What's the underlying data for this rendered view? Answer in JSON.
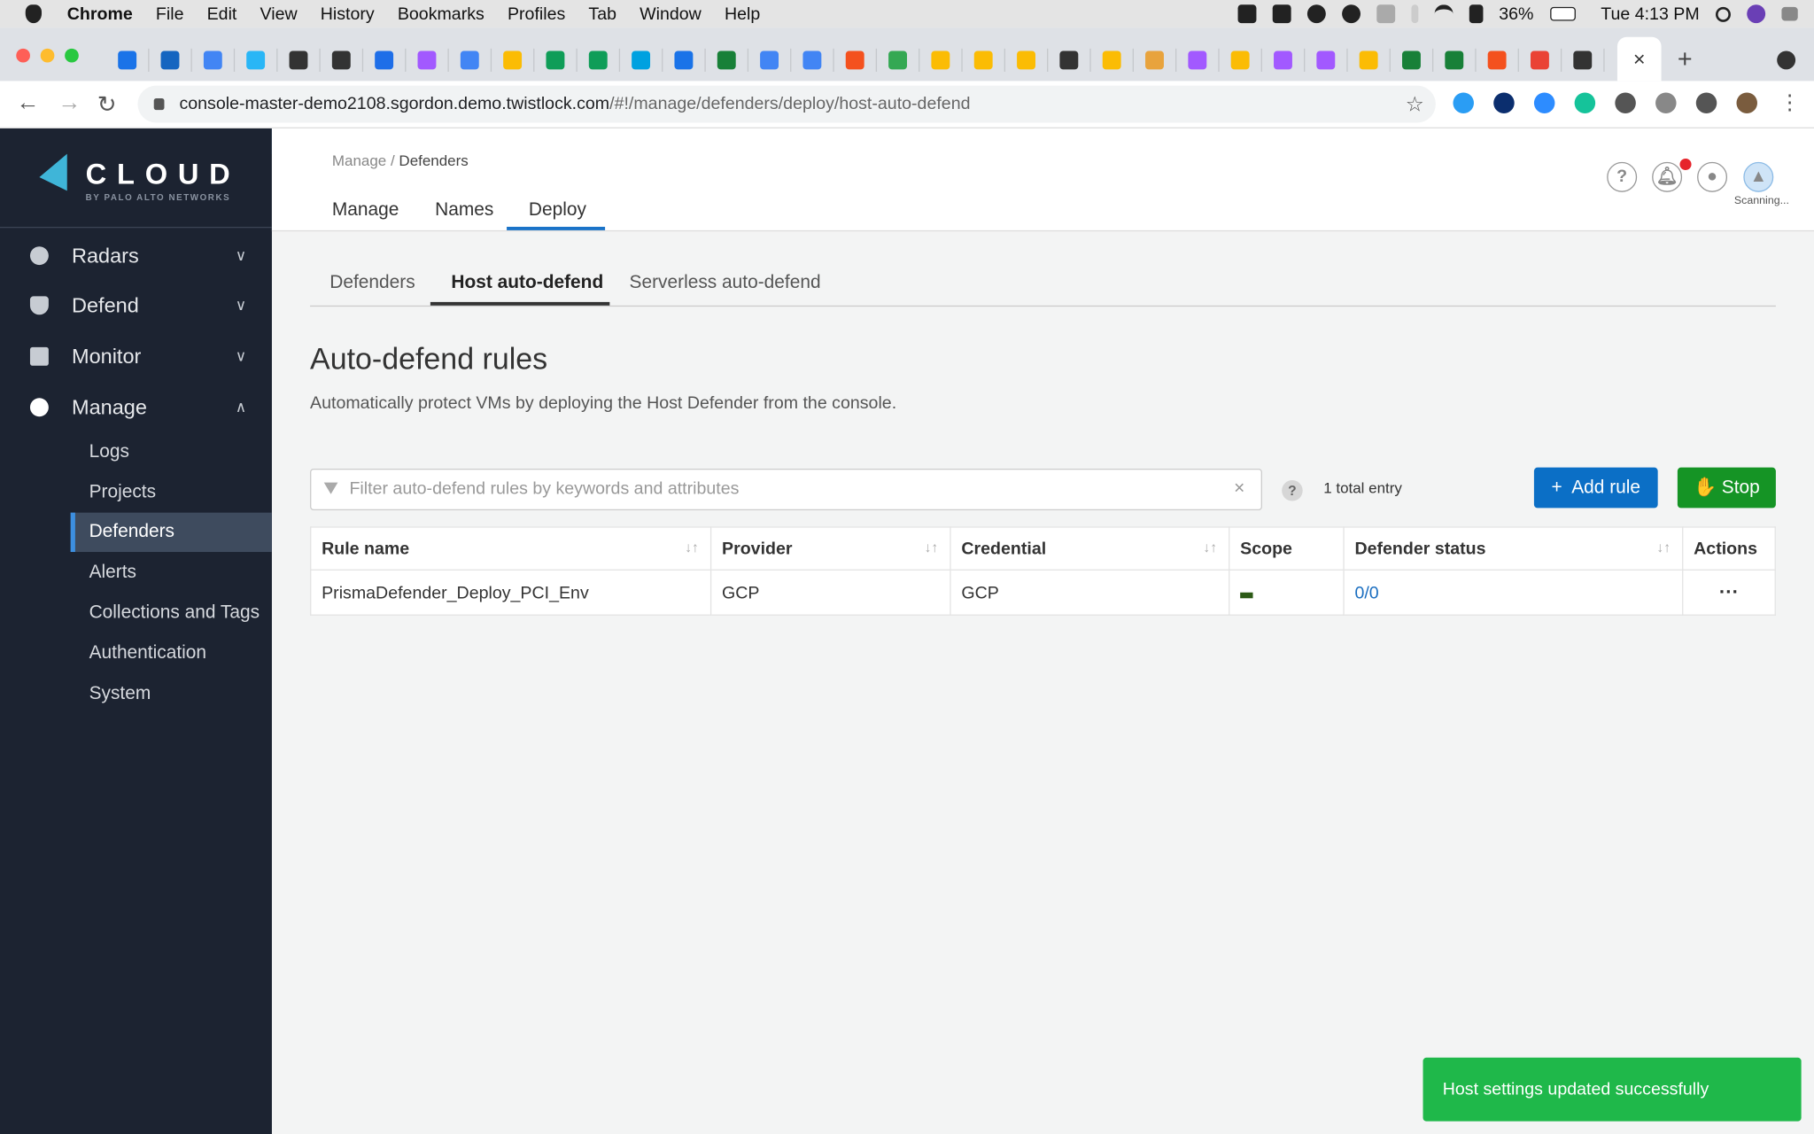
{
  "macos_menubar": {
    "app": "Chrome",
    "menus": [
      "File",
      "Edit",
      "View",
      "History",
      "Bookmarks",
      "Profiles",
      "Tab",
      "Window",
      "Help"
    ],
    "battery": "36%",
    "clock": "Tue 4:13 PM"
  },
  "browser": {
    "tab_icon_colors": [
      "#1a73e8",
      "#1565c0",
      "#4285f4",
      "#29b6f6",
      "#333333",
      "#333333",
      "#1e6ee8",
      "#a259ff",
      "#4285f4",
      "#fbbc04",
      "#0f9d58",
      "#0f9d58",
      "#00a1e0",
      "#1a73e8",
      "#188038",
      "#4285f4",
      "#4285f4",
      "#f4511e",
      "#34a853",
      "#fbbc04",
      "#fbbc04",
      "#fbbc04",
      "#333333",
      "#fbbc04",
      "#e8a33d",
      "#a259ff",
      "#fbbc04",
      "#a259ff",
      "#a259ff",
      "#fbbc04",
      "#188038",
      "#188038",
      "#f4511e",
      "#ea4335",
      "#333333"
    ],
    "active_tab_close": "×",
    "new_tab": "+",
    "url_host": "console-master-demo2108.sgordon.demo.twistlock.com",
    "url_path": "/#!/manage/defenders/deploy/host-auto-defend",
    "extension_colors": [
      "#2a9df4",
      "#0b2e6e",
      "#2d8cff",
      "#15c39a",
      "#555555",
      "#888888",
      "#555555",
      "#7a5c3e"
    ]
  },
  "sidebar": {
    "logo_text": "CLOUD",
    "logo_sub": "BY PALO ALTO NETWORKS",
    "sections": [
      {
        "label": "Radars",
        "expanded": false
      },
      {
        "label": "Defend",
        "expanded": false
      },
      {
        "label": "Monitor",
        "expanded": false
      },
      {
        "label": "Manage",
        "expanded": true
      }
    ],
    "manage_items": [
      "Logs",
      "Projects",
      "Defenders",
      "Alerts",
      "Collections and Tags",
      "Authentication",
      "System"
    ],
    "active_item": "Defenders"
  },
  "header": {
    "breadcrumb_parent": "Manage",
    "breadcrumb_sep": "/",
    "breadcrumb_current": "Defenders",
    "tabs": [
      "Manage",
      "Names",
      "Deploy"
    ],
    "active_tab": "Deploy",
    "help": "?",
    "scan_status": "Scanning...",
    "notification_badge_color": "#e6242b"
  },
  "subtabs": {
    "items": [
      "Defenders",
      "Host auto-defend",
      "Serverless auto-defend"
    ],
    "active": "Host auto-defend"
  },
  "main": {
    "title": "Auto-defend rules",
    "description": "Automatically protect VMs by deploying the Host Defender from the console.",
    "filter_placeholder": "Filter auto-defend rules by keywords and attributes",
    "filter_clear": "×",
    "help": "?",
    "total": "1 total entry",
    "add_rule": "Add rule",
    "add_icon": "+",
    "stop": "Stop",
    "stop_icon": "✋",
    "table": {
      "columns": [
        "Rule name",
        "Provider",
        "Credential",
        "Scope",
        "Defender status",
        "Actions"
      ],
      "sort_glyph": "↓↑",
      "rows": [
        {
          "rule_name": "PrismaDefender_Deploy_PCI_Env",
          "provider": "GCP",
          "credential": "GCP",
          "scope_color": "#2c5a16",
          "defender_status": "0/0",
          "actions": "···"
        }
      ]
    }
  },
  "toast": {
    "message": "Host settings updated successfully",
    "color": "#1fb84a"
  }
}
